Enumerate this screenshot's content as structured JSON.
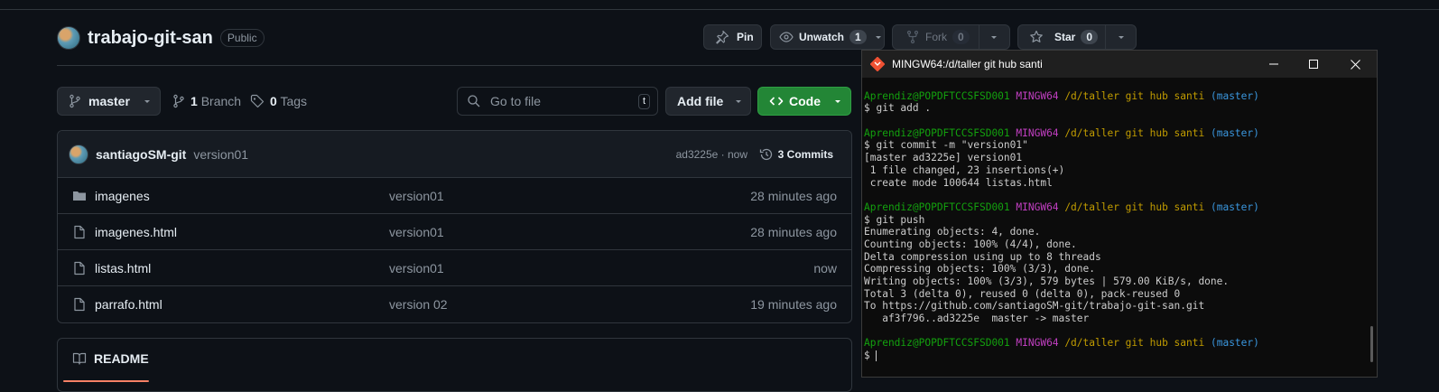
{
  "repo": {
    "name": "trabajo-git-san",
    "visibility": "Public"
  },
  "actions": {
    "pin": "Pin",
    "unwatch": "Unwatch",
    "watch_count": "1",
    "fork": "Fork",
    "fork_count": "0",
    "star": "Star",
    "star_count": "0"
  },
  "toolbar": {
    "branch": "master",
    "branch_count": "1",
    "branch_label": "Branch",
    "tags_count": "0",
    "tags_label": "Tags",
    "search_placeholder": "Go to file",
    "search_kbd": "t",
    "add_file": "Add file",
    "code": "Code"
  },
  "commit": {
    "author": "santiagoSM-git",
    "message": "version01",
    "hash_time": "ad3225e · now",
    "commits": "3 Commits"
  },
  "files": [
    {
      "type": "folder",
      "name": "imagenes",
      "message": "version01",
      "time": "28 minutes ago"
    },
    {
      "type": "file",
      "name": "imagenes.html",
      "message": "version01",
      "time": "28 minutes ago"
    },
    {
      "type": "file",
      "name": "listas.html",
      "message": "version01",
      "time": "now"
    },
    {
      "type": "file",
      "name": "parrafo.html",
      "message": "version 02",
      "time": "19 minutes ago"
    }
  ],
  "readme": {
    "label": "README"
  },
  "terminal": {
    "title": "MINGW64:/d/taller git hub santi",
    "prompt": {
      "user": "Aprendiz@POPDFTCCSFSD001",
      "mingw": "MINGW64",
      "path": "/d/taller git hub santi",
      "branch": "(master)"
    },
    "lines": [
      "",
      "",
      "$ git add .",
      "",
      "",
      "$ git commit -m \"version01\"",
      "[master ad3225e] version01",
      " 1 file changed, 23 insertions(+)",
      " create mode 100644 listas.html",
      "",
      "",
      "$ git push",
      "Enumerating objects: 4, done.",
      "Counting objects: 100% (4/4), done.",
      "Delta compression using up to 8 threads",
      "Compressing objects: 100% (3/3), done.",
      "Writing objects: 100% (3/3), 579 bytes | 579.00 KiB/s, done.",
      "Total 3 (delta 0), reused 0 (delta 0), pack-reused 0",
      "To https://github.com/santiagoSM-git/trabajo-git-san.git",
      "   af3f796..ad3225e  master -> master",
      "",
      "",
      "$ "
    ],
    "prompt_lines": [
      1,
      4,
      10,
      21
    ]
  },
  "colors": {
    "accent_green": "#238636",
    "bg": "#0d1117",
    "border": "#30363d",
    "readme_underline": "#f78166"
  }
}
